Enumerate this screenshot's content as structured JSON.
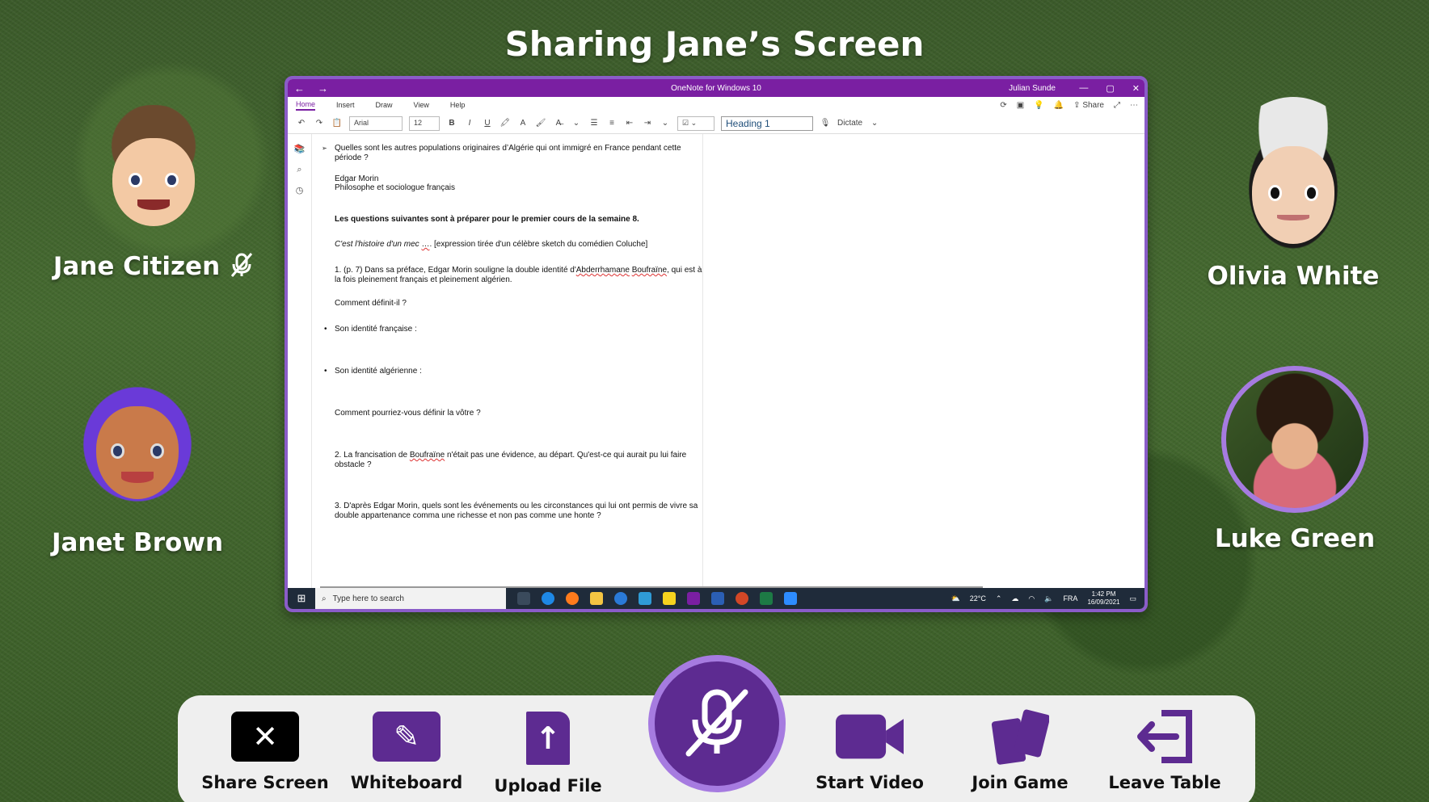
{
  "page_title": "Sharing Jane’s Screen",
  "participants": {
    "jane": {
      "name": "Jane Citizen"
    },
    "olivia": {
      "name": "Olivia White"
    },
    "janet": {
      "name": "Janet Brown"
    },
    "luke": {
      "name": "Luke Green"
    }
  },
  "shared_window": {
    "app_title": "OneNote for Windows 10",
    "user": "Julian Sunde",
    "menu": [
      "Home",
      "Insert",
      "Draw",
      "View",
      "Help"
    ],
    "menu_right": {
      "share": "Share"
    },
    "font_name": "Arial",
    "font_size": "12",
    "style": "Heading 1",
    "dictate": "Dictate",
    "note_lines": {
      "l1": "Quelles sont les autres populations originaires d’Algérie qui ont immigré en France pendant cette période ?",
      "l2": "Edgar Morin",
      "l3": "Philosophe et sociologue français",
      "l4": "Les questions suivantes sont à préparer pour le premier cours de la semaine 8.",
      "l5a": "C'est l'histoire d'un mec",
      "l5b": "…",
      "l5c": ". [expression tirée d'un célèbre sketch du comédien Coluche]",
      "l6a": "1. (p. 7) Dans sa préface, Edgar Morin souligne la double identité d'",
      "l6b": "Abderrhamane",
      "l6c": "Boufraïne",
      "l6d": ", qui est à la fois pleinement français et pleinement algérien.",
      "l7": "Comment définit-il ?",
      "l8": "Son identité française :",
      "l9": "Son identité algérienne :",
      "l10": "Comment pourriez-vous définir la vôtre ?",
      "l11a": "2. La francisation de ",
      "l11b": "Boufraïne",
      "l11c": " n'était pas une évidence, au départ. Qu'est-ce qui aurait pu lui faire obstacle ?",
      "l12": "3. D'après Edgar Morin, quels sont les événements ou les circonstances qui lui ont permis de vivre sa double appartenance comma une richesse et non pas comme une honte ?"
    },
    "taskbar": {
      "search_placeholder": "Type here to search",
      "weather": "22°C",
      "lang": "FRA",
      "time": "1:42 PM",
      "date": "16/09/2021"
    }
  },
  "toolbar": {
    "share_screen": "Share Screen",
    "whiteboard": "Whiteboard",
    "upload_file": "Upload File",
    "start_video": "Start Video",
    "join_game": "Join Game",
    "leave_table": "Leave Table"
  },
  "colors": {
    "accent": "#5d2b91",
    "accent_light": "#a67be0",
    "onenote": "#7a1fa2"
  }
}
